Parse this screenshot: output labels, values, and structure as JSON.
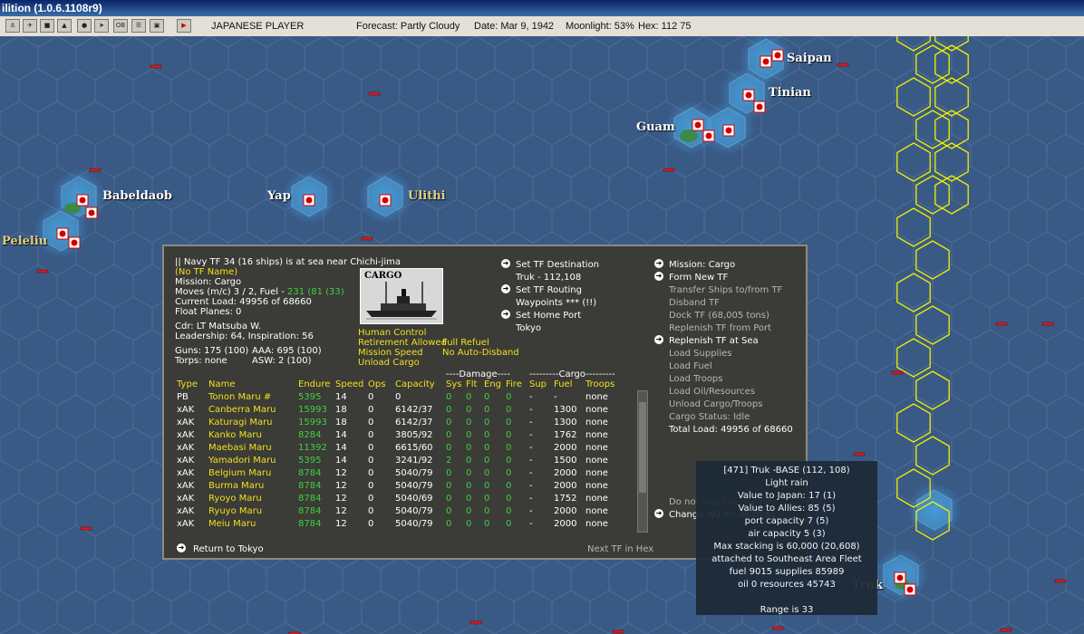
{
  "window": {
    "title": "ilition (1.0.6.1108r9)"
  },
  "status_bar": {
    "side": "JAPANESE PLAYER",
    "forecast": "Forecast: Partly Cloudy",
    "date": "Date: Mar 9, 1942",
    "moonlight": "Moonlight: 53%",
    "hex": "Hex: 112 75"
  },
  "toolbar_icons": [
    "ships-icon",
    "airgroups-icon",
    "bases-icon",
    "lcu-icon",
    "globe-icon",
    "aircraft-icon",
    "ob-icon",
    "reports-icon",
    "intel-icon",
    "end-turn-icon"
  ],
  "toolbar_ob_label": "OB",
  "map": {
    "labels": {
      "saipan": "Saipan",
      "tinian": "Tinian",
      "guam": "Guam",
      "babeldaob": "Babeldaob",
      "yap": "Yap",
      "ulithi": "Ulithi",
      "peleliu": "Peleliu",
      "truk": "Truk"
    }
  },
  "tf_panel": {
    "header": "|| Navy TF 34 (16 ships) is at sea near Chichi-jima",
    "tf_name": "(No TF Name)",
    "mission": "Mission: Cargo",
    "moves_prefix": "Moves (m/c) 3 / 2, Fuel - ",
    "moves_fuel": "231 (81 (33)",
    "current_load": "Current Load: 49956 of 68660",
    "float_planes": "Float Planes: 0",
    "cdr": "Cdr: LT  Matsuba W.",
    "leadership": "Leadership: 64, Inspiration: 56",
    "guns": "Guns: 175 (100)",
    "aaa": "AAA: 695 (100)",
    "torps": "Torps: none",
    "asw": "ASW: 2 (100)",
    "photo_label": "CARGO",
    "control": {
      "human_control": "Human Control",
      "retirement": "Retirement Allowed",
      "full_refuel": "Full Refuel",
      "mission_speed": "Mission Speed",
      "no_auto_disband": "No Auto-Disband",
      "unload_cargo": "Unload Cargo"
    },
    "mid_menu": {
      "set_destination": "Set TF Destination",
      "destination_value": "Truk - 112,108",
      "set_routing": "Set TF Routing",
      "waypoints": "Waypoints *** (!!)",
      "set_home_port": "Set Home Port",
      "home_port_value": "Tokyo"
    },
    "right_menu": {
      "mission": "Mission: Cargo",
      "form_new_tf": "Form New TF",
      "transfer_ships": "Transfer Ships to/from TF",
      "disband_tf": "Disband TF",
      "dock_tf": "Dock TF (68,005 tons)",
      "replenish_from_port": "Replenish TF from Port",
      "replenish_at_sea": "Replenish TF at Sea",
      "load_supplies": "Load Supplies",
      "load_fuel": "Load Fuel",
      "load_troops": "Load Troops",
      "load_oil": "Load Oil/Resources",
      "unload_cargo_troops": "Unload Cargo/Troops",
      "cargo_status": "Cargo Status: Idle",
      "total_load": "Total Load: 49956 of 68660",
      "do_not_react": "Do not react to enemy",
      "change_hq": "Change HQ for all ships"
    },
    "table": {
      "group_damage": "----Damage----",
      "group_cargo": "---------Cargo---------",
      "headers": {
        "type": "Type",
        "name": "Name",
        "endure": "Endure",
        "speed": "Speed",
        "ops": "Ops",
        "capacity": "Capacity",
        "sys": "Sys",
        "flt": "Flt",
        "eng": "Eng",
        "fire": "Fire",
        "sup": "Sup",
        "fuel": "Fuel",
        "troops": "Troops"
      },
      "rows": [
        {
          "type": "PB",
          "name": "Tonon Maru #",
          "endure": "5395",
          "speed": "14",
          "ops": "0",
          "capacity": "0",
          "sys": "0",
          "flt": "0",
          "eng": "0",
          "fire": "0",
          "sup": "-",
          "fuel": "-",
          "troops": "none"
        },
        {
          "type": "xAK",
          "name": "Canberra Maru",
          "endure": "15993",
          "speed": "18",
          "ops": "0",
          "capacity": "6142/37",
          "sys": "0",
          "flt": "0",
          "eng": "0",
          "fire": "0",
          "sup": "-",
          "fuel": "1300",
          "troops": "none"
        },
        {
          "type": "xAK",
          "name": "Katuragi Maru",
          "endure": "15993",
          "speed": "18",
          "ops": "0",
          "capacity": "6142/37",
          "sys": "0",
          "flt": "0",
          "eng": "0",
          "fire": "0",
          "sup": "-",
          "fuel": "1300",
          "troops": "none"
        },
        {
          "type": "xAK",
          "name": "Kanko Maru",
          "endure": "8284",
          "speed": "14",
          "ops": "0",
          "capacity": "3805/92",
          "sys": "0",
          "flt": "0",
          "eng": "0",
          "fire": "0",
          "sup": "-",
          "fuel": "1762",
          "troops": "none"
        },
        {
          "type": "xAK",
          "name": "Maebasi Maru",
          "endure": "11392",
          "speed": "14",
          "ops": "0",
          "capacity": "6615/60",
          "sys": "0",
          "flt": "0",
          "eng": "0",
          "fire": "0",
          "sup": "-",
          "fuel": "2000",
          "troops": "none"
        },
        {
          "type": "xAK",
          "name": "Yamadori Maru",
          "endure": "5395",
          "speed": "14",
          "ops": "0",
          "capacity": "3241/92",
          "sys": "2",
          "flt": "0",
          "eng": "0",
          "fire": "0",
          "sup": "-",
          "fuel": "1500",
          "troops": "none"
        },
        {
          "type": "xAK",
          "name": "Belgium Maru",
          "endure": "8784",
          "speed": "12",
          "ops": "0",
          "capacity": "5040/79",
          "sys": "0",
          "flt": "0",
          "eng": "0",
          "fire": "0",
          "sup": "-",
          "fuel": "2000",
          "troops": "none"
        },
        {
          "type": "xAK",
          "name": "Burma Maru",
          "endure": "8784",
          "speed": "12",
          "ops": "0",
          "capacity": "5040/79",
          "sys": "0",
          "flt": "0",
          "eng": "0",
          "fire": "0",
          "sup": "-",
          "fuel": "2000",
          "troops": "none"
        },
        {
          "type": "xAK",
          "name": "Ryoyo Maru",
          "endure": "8784",
          "speed": "12",
          "ops": "0",
          "capacity": "5040/69",
          "sys": "0",
          "flt": "0",
          "eng": "0",
          "fire": "0",
          "sup": "-",
          "fuel": "1752",
          "troops": "none"
        },
        {
          "type": "xAK",
          "name": "Ryuyo Maru",
          "endure": "8784",
          "speed": "12",
          "ops": "0",
          "capacity": "5040/79",
          "sys": "0",
          "flt": "0",
          "eng": "0",
          "fire": "0",
          "sup": "-",
          "fuel": "2000",
          "troops": "none"
        },
        {
          "type": "xAK",
          "name": "Meiu Maru",
          "endure": "8784",
          "speed": "12",
          "ops": "0",
          "capacity": "5040/79",
          "sys": "0",
          "flt": "0",
          "eng": "0",
          "fire": "0",
          "sup": "-",
          "fuel": "2000",
          "troops": "none"
        }
      ]
    },
    "return_to": "Return to Tokyo",
    "next_tf": "Next TF in Hex"
  },
  "tooltip": {
    "lines": [
      "[471] Truk  -BASE  (112, 108)",
      "Light rain",
      "Value to Japan:  17 (1)",
      "Value to Allies:  85 (5)",
      "port capacity 7 (5)",
      "air capacity 5 (3)",
      "Max stacking is 60,000  (20,608)",
      "attached to Southeast Area Fleet",
      "fuel 9015  supplies 85989",
      "oil 0  resources 45743",
      "",
      "Range is 33"
    ]
  },
  "colors": {
    "ocean": "#3a5a86",
    "hex_line": "#4e6e98",
    "highlight": "#f0f000",
    "panel": "#3b3b37",
    "yellow_text": "#f0e020",
    "green_text": "#40d040"
  }
}
